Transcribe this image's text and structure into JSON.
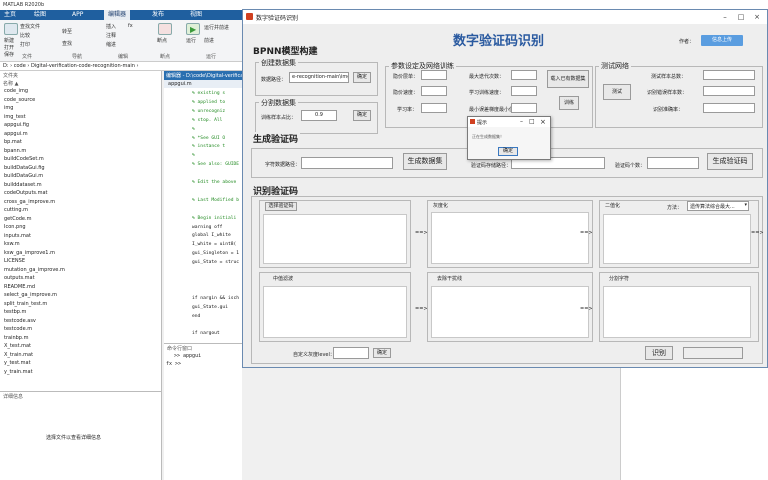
{
  "matlab": {
    "title": "MATLAB R2020b",
    "tabs": [
      "主页",
      "绘图",
      "APP",
      "编辑器",
      "发布",
      "视图"
    ],
    "active_tab": "编辑器",
    "ribbon": {
      "new": "新建",
      "open": "打开",
      "save": "保存",
      "find_files": "查找文件",
      "compare": "比较",
      "print": "打印",
      "goto": "转至",
      "find": "查找",
      "insert": "插入",
      "comment": "注释",
      "indent": "缩进",
      "breakpoint": "断点",
      "run": "运行",
      "run_advance": "运行并前进",
      "advance": "前进",
      "group_file": "文件",
      "group_nav": "导航",
      "group_edit": "编辑",
      "group_bp": "断点",
      "group_run": "运行"
    },
    "address": "D: › code › Digital-verification-code-recognition-main ›",
    "file_panel_title": "文件夹",
    "name_col": "名称 ▲",
    "files": [
      "code_img",
      "code_source",
      "img",
      "img_test",
      "appgui.fig",
      "appgui.m",
      "bp.mat",
      "bpann.m",
      "buildCodeSet.m",
      "buildDataGui.fig",
      "buildDataGui.m",
      "builddataset.m",
      "codeOutputs.mat",
      "cross_ga_improve.m",
      "cutting.m",
      "getCode.m",
      "Icon.png",
      "inputs.mat",
      "ksw.m",
      "ksw_ga_improve1.m",
      "LICENSE",
      "mutation_ga_improve.m",
      "outputs.mat",
      "README.md",
      "select_ga_improve.m",
      "split_train_test.m",
      "testbp.m",
      "testcode.asv",
      "testcode.m",
      "trainbp.m",
      "X_test.mat",
      "X_train.mat",
      "y_test.mat",
      "y_train.mat"
    ],
    "detail_title": "详细信息",
    "detail_text": "选择文件以查看详细信息",
    "editor_tab": "编辑器 - D:\\code\\Digital-verification...",
    "editor_file": "appgui.m",
    "code_lines": [
      {
        "n": "",
        "t": "%      existing s"
      },
      {
        "n": "",
        "t": "%      applied to"
      },
      {
        "n": "",
        "t": "%      unrecogniz"
      },
      {
        "n": "",
        "t": "%      stop.  All"
      },
      {
        "n": "",
        "t": "%"
      },
      {
        "n": "",
        "t": "%      *See GUI O"
      },
      {
        "n": "",
        "t": "%      instance t"
      },
      {
        "n": "",
        "t": "%"
      },
      {
        "n": "",
        "t": "% See also: GUIDE"
      },
      {
        "n": "",
        "t": ""
      },
      {
        "n": "",
        "t": "% Edit the above"
      },
      {
        "n": "",
        "t": ""
      },
      {
        "n": "",
        "t": "% Last Modified b"
      },
      {
        "n": "",
        "t": ""
      },
      {
        "n": "",
        "t": "% Begin initiali"
      },
      {
        "n": "",
        "t": "warning off"
      },
      {
        "n": "",
        "t": "global I_white"
      },
      {
        "n": "",
        "t": "I_white = uint8("
      },
      {
        "n": "",
        "t": "gui_Singleton = 1"
      },
      {
        "n": "",
        "t": "gui_State = struc"
      },
      {
        "n": "",
        "t": ""
      },
      {
        "n": "",
        "t": ""
      },
      {
        "n": "",
        "t": ""
      },
      {
        "n": "",
        "t": "if nargin && isch"
      },
      {
        "n": "",
        "t": "    gui_State.gui"
      },
      {
        "n": "",
        "t": "end"
      },
      {
        "n": "",
        "t": ""
      },
      {
        "n": "",
        "t": "if nargout"
      }
    ],
    "cmd_title": "命令行窗口",
    "cmd_lines": [
      ">> appgui",
      "fx >>"
    ]
  },
  "gui": {
    "window_title": "数字验证码识别",
    "main_title": "数字验证码识别",
    "author_label": "作者：",
    "author_badge": "信息上传",
    "bpnn_title": "BPNN模型构建",
    "create_dataset": "创建数据集",
    "data_path_label": "数据路径：",
    "data_path_value": "e-recognition-main\\img\\",
    "confirm": "确定",
    "split_dataset": "分割数据集",
    "train_ratio_label": "训练样本占比：",
    "train_ratio_value": "0.9",
    "param_title": "参数设定及网络训练",
    "hidden_layers_label": "隐价层单：",
    "hidden_rate_label": "隐价速度：",
    "learn_rate_label": "学习率：",
    "max_iter_label": "最大迭代次数：",
    "train_target_label": "学习训练速度：",
    "min_error_label": "最小误差梯度最小值：",
    "load_model_btn": "载入已有数据集",
    "train_btn": "训练",
    "test_title": "测试网络",
    "test_btn": "测试",
    "test_total_label": "测试样本总数：",
    "test_correct_label": "识别错误样本数：",
    "test_acc_label": "识别准确率：",
    "gen_title": "生成验证码",
    "cap_save_label": "字符数据路径：",
    "gen_data_btn": "生成数据集",
    "cap_path_label": "验证码存储路径：",
    "cap_count_label": "验证码个数：",
    "gen_cap_btn": "生成验证码",
    "recog_title": "识别验证码",
    "select_cap_btn": "选择验证码",
    "gray_label": "灰度化",
    "binary_label": "二值化",
    "method_label": "方法：",
    "method_value": "遗传算法综合最大...",
    "denoise_label": "中值滤波",
    "remove_label": "去除干扰线",
    "split_label": "分割字符",
    "arrow": "==>",
    "custom_gray_label": "自定义灰度level：",
    "recognize_btn": "识别"
  },
  "dialog": {
    "title": "提示",
    "message": "正在生成数据集！",
    "ok": "确定"
  }
}
